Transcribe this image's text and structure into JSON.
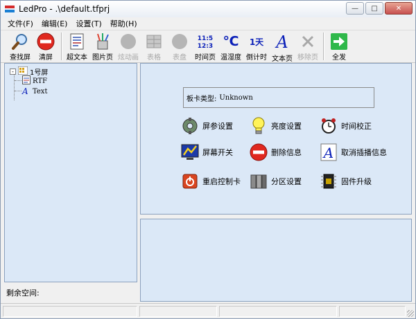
{
  "window": {
    "title": "LedPro - .\\default.tfprj",
    "minimize_glyph": "—",
    "maximize_glyph": "□",
    "close_glyph": "✕"
  },
  "menu": [
    "文件(F)",
    "编辑(E)",
    "设置(T)",
    "帮助(H)"
  ],
  "toolbar": {
    "find_screen": "查找屏",
    "clear_screen": "清屏",
    "super_text": "超文本",
    "picture_page": "图片页",
    "animation": "炫动画",
    "table": "表格",
    "dial": "表盘",
    "time_page": "时间页",
    "time_page_icon": "11:5\n12:3",
    "temp_humidity": "温湿度",
    "temp_icon": "℃",
    "countdown": "倒计时",
    "countdown_icon": "1天",
    "text_page": "文本页",
    "text_icon": "A",
    "remove_page": "移除页",
    "send_all": "全发"
  },
  "tree": {
    "root": "1号屏",
    "children": [
      "RTF",
      "Text"
    ],
    "expander": "-"
  },
  "left_status": "剩余空间:",
  "card_type": {
    "label": "板卡类型:",
    "value": "Unknown"
  },
  "actions": {
    "screen_params": "屏参设置",
    "brightness": "亮度设置",
    "time_calibration": "时间校正",
    "screen_switch": "屏幕开关",
    "delete_info": "删除信息",
    "cancel_interrupt": "取消插播信息",
    "restart_card": "重启控制卡",
    "zone_settings": "分区设置",
    "firmware_upgrade": "固件升级"
  },
  "colors": {
    "panel_bg": "#dbe8f7",
    "panel_border": "#8aa0bd",
    "window_bg": "#f0f0f0",
    "clear_red": "#e0281f",
    "send_green": "#2fb84a",
    "text_blue": "#0a1fb8"
  }
}
